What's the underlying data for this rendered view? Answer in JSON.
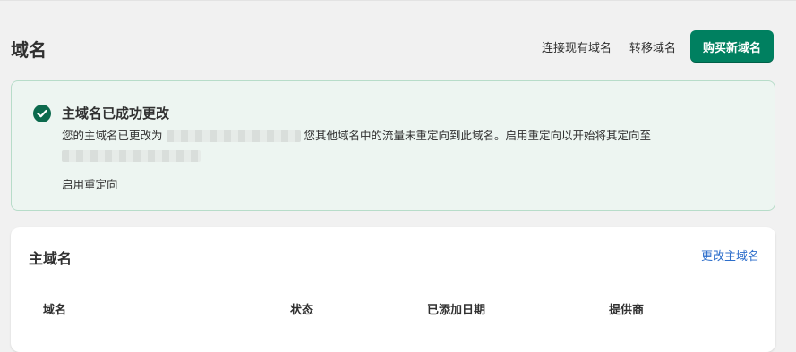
{
  "page": {
    "title": "域名"
  },
  "header": {
    "connect_label": "连接现有域名",
    "transfer_label": "转移域名",
    "buy_label": "购买新域名"
  },
  "banner": {
    "icon": "check-circle-icon",
    "title": "主域名已成功更改",
    "body_before": "您的主域名已更改为",
    "body_after": "您其他域名中的流量未重定向到此域名。启用重定向以开始将其定向至",
    "action_label": "启用重定向"
  },
  "primary_domain_card": {
    "title": "主域名",
    "action_label": "更改主域名",
    "columns": [
      "域名",
      "状态",
      "已添加日期",
      "提供商"
    ]
  },
  "colors": {
    "primary": "#008060",
    "link": "#2c6ecb",
    "success_bg": "#edf5f1",
    "success_border": "#b7dcc9",
    "success_icon": "#0c6a4d"
  }
}
